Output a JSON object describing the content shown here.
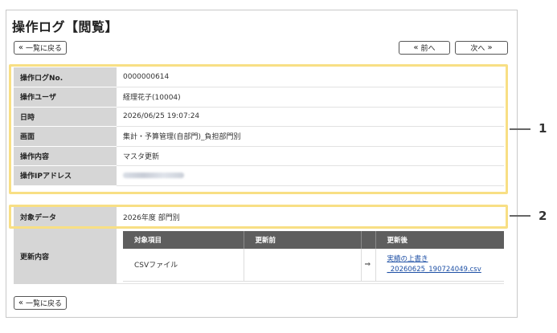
{
  "page": {
    "title": "操作ログ【閲覧】"
  },
  "nav": {
    "back_label": "一覧に戻る",
    "back_arrow": "«",
    "prev_label": "前へ",
    "prev_arrow": "«",
    "next_label": "次へ",
    "next_arrow": "»"
  },
  "info": {
    "rows": [
      {
        "label": "操作ログNo.",
        "value": "0000000614"
      },
      {
        "label": "操作ユーザ",
        "value": "経理花子(10004)"
      },
      {
        "label": "日時",
        "value": "2026/06/25 19:07:24"
      },
      {
        "label": "画面",
        "value": "集計・予算管理(自部門)_負担部門別"
      },
      {
        "label": "操作内容",
        "value": "マスタ更新"
      },
      {
        "label": "操作IPアドレス",
        "value": ""
      }
    ]
  },
  "target": {
    "label": "対象データ",
    "value": "2026年度 部門別"
  },
  "update": {
    "label": "更新内容",
    "headers": [
      "対象項目",
      "更新前",
      "",
      "更新後"
    ],
    "row": {
      "item": "CSVファイル",
      "before": "",
      "arrow": "⇒",
      "after_line1": "実績の上書き",
      "after_line2": "_20260625_190724049.csv"
    }
  },
  "callouts": [
    "1",
    "2"
  ],
  "colors": {
    "highlight": "#f8df84",
    "label_bg": "#d6d6d6",
    "header_bg": "#5e5e5e",
    "link": "#1d4fa5"
  }
}
